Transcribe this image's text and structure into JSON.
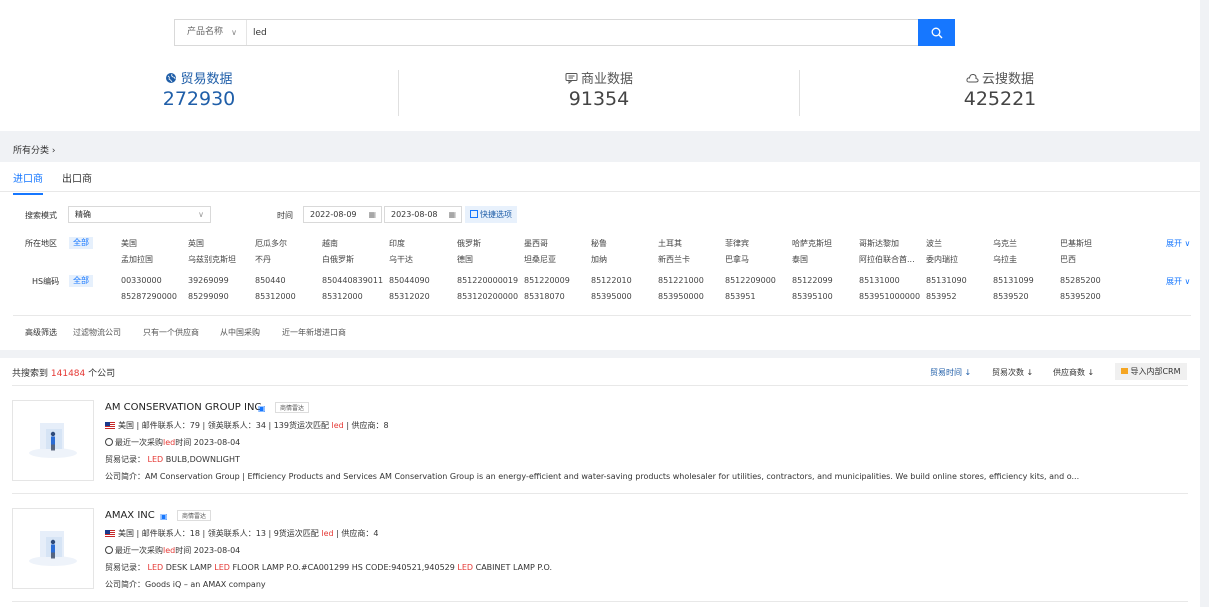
{
  "search": {
    "category": "产品名称",
    "query": "led"
  },
  "stats": [
    {
      "label": "贸易数据",
      "value": "272930",
      "icon": "globe-icon"
    },
    {
      "label": "商业数据",
      "value": "91354",
      "icon": "chat-icon"
    },
    {
      "label": "云搜数据",
      "value": "425221",
      "icon": "cloud-icon"
    }
  ],
  "breadcrumb": "所有分类 ›",
  "tabs": [
    "进口商",
    "出口商"
  ],
  "filters": {
    "mode_label": "搜索模式",
    "mode_value": "精确",
    "time_label": "时间",
    "date_from": "2022-08-09",
    "date_to": "2023-08-08",
    "quick_label": "快捷选项",
    "region_label": "所在地区",
    "all_label": "全部",
    "hs_label": "HS编码",
    "expand_label": "展开 ∨",
    "regions": [
      "美国",
      "英国",
      "厄瓜多尔",
      "越南",
      "印度",
      "俄罗斯",
      "墨西哥",
      "秘鲁",
      "土耳其",
      "菲律宾",
      "哈萨克斯坦",
      "哥斯达黎加",
      "波兰",
      "乌克兰",
      "巴基斯坦",
      "孟加拉国",
      "乌兹别克斯坦",
      "不丹",
      "白俄罗斯",
      "乌干达",
      "德国",
      "坦桑尼亚",
      "加纳",
      "新西兰卡",
      "巴拿马",
      "泰国",
      "阿拉伯联合酋...",
      "委内瑞拉",
      "乌拉圭",
      "巴西"
    ],
    "hs_codes": [
      "00330000",
      "39269099",
      "850440",
      "850440839011",
      "85044090",
      "851220000019",
      "851220009",
      "85122010",
      "851221000",
      "8512209000",
      "85122099",
      "85131000",
      "85131090",
      "85131099",
      "85285200",
      "85287290000",
      "85299090",
      "85312000",
      "85312000",
      "85312020",
      "853120200000",
      "85318070",
      "85395000",
      "853950000",
      "853951",
      "85395100",
      "853951000000",
      "853952",
      "8539520",
      "85395200"
    ],
    "advanced_label": "高级筛选",
    "advanced_options": [
      "过滤物流公司",
      "只有一个供应商",
      "从中国采购",
      "近一年新增进口商"
    ]
  },
  "results": {
    "prefix": "共搜索到",
    "count": "141484",
    "suffix": "个公司",
    "sort_buttons": [
      "贸易时间 ↓",
      "贸易次数 ↓",
      "供应商数 ↓"
    ],
    "crm_label": "导入内部CRM",
    "radar_label": "商情雷达",
    "companies": [
      {
        "name": "AM CONSERVATION GROUP INC",
        "country": "美国",
        "info": "| 邮件联系人：79 | 领英联系人：34 | 139货运次匹配",
        "match": "led",
        "suppliers": "| 供应商：8",
        "last_prefix": "最近一次采购",
        "last_kw": "led",
        "last_suffix": "时间 2023-08-04",
        "trade_prefix": "贸易记录：",
        "trade_kw1": "LED",
        "trade_text1": "BULB,DOWNLIGHT",
        "trade_kw2": "",
        "trade_text2": "",
        "trade_kw3": "",
        "trade_text3": "",
        "intro": "公司简介：AM Conservation Group | Efficiency Products and Services AM Conservation Group is an energy-efficient and water-saving products wholesaler for utilities, contractors, and municipalities. We build online stores, efficiency kits, and o..."
      },
      {
        "name": "AMAX INC",
        "country": "美国",
        "info": "| 邮件联系人：18 | 领英联系人：13 | 9货运次匹配",
        "match": "led",
        "suppliers": "| 供应商：4",
        "last_prefix": "最近一次采购",
        "last_kw": "led",
        "last_suffix": "时间 2023-08-04",
        "trade_prefix": "贸易记录：",
        "trade_kw1": "LED",
        "trade_text1": "DESK LAMP",
        "trade_kw2": "LED",
        "trade_text2": "FLOOR LAMP P.O.#CA001299 HS CODE:940521,940529",
        "trade_kw3": "LED",
        "trade_text3": "CABINET LAMP P.O.",
        "intro": "公司简介：Goods iQ – an AMAX company"
      }
    ]
  },
  "colors": {
    "accent": "#1677ff",
    "highlight": "#e53935",
    "stat_blue": "#1f5ea8"
  }
}
